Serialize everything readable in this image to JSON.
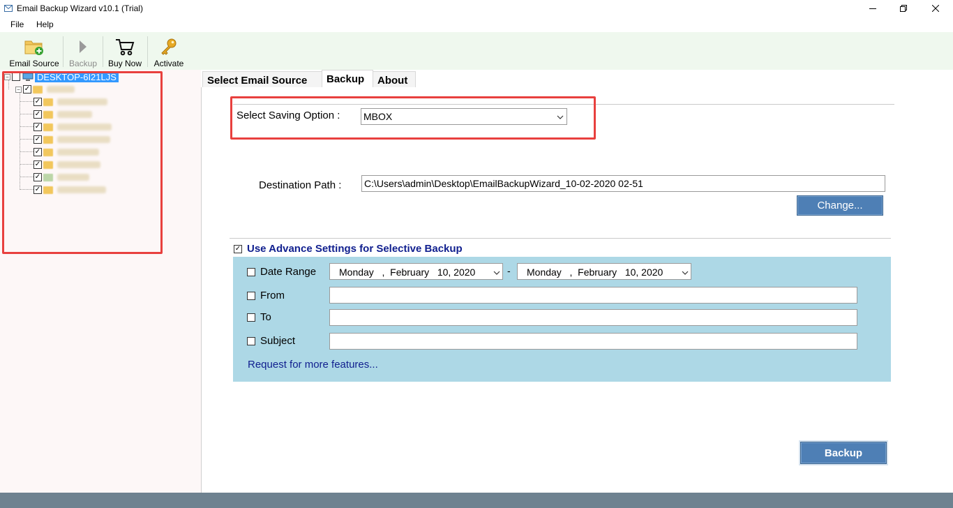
{
  "window": {
    "title": "Email Backup Wizard v10.1 (Trial)"
  },
  "menu": {
    "file": "File",
    "help": "Help"
  },
  "toolbar": {
    "email_source": "Email Source",
    "backup": "Backup",
    "buy_now": "Buy Now",
    "activate": "Activate"
  },
  "tree": {
    "root_label": "DESKTOP-6I21LJS",
    "root_checked": false,
    "children_checked": true
  },
  "tabs": {
    "select_email_source": "Select Email Source",
    "backup": "Backup",
    "about": "About",
    "active": "Backup"
  },
  "saving": {
    "label": "Select Saving Option :",
    "selected": "MBOX"
  },
  "destination": {
    "label": "Destination Path :",
    "value": "C:\\Users\\admin\\Desktop\\EmailBackupWizard_10-02-2020 02-51",
    "change_button": "Change..."
  },
  "advanced": {
    "label": "Use Advance Settings for Selective Backup",
    "checked": true,
    "date_range_label": "Date Range",
    "date_from": "Monday   ,  February   10, 2020",
    "date_separator": "-",
    "date_to": "Monday   ,  February   10, 2020",
    "from_label": "From",
    "to_label": "To",
    "subject_label": "Subject",
    "request_link": "Request for more features..."
  },
  "actions": {
    "backup_button": "Backup"
  },
  "colors": {
    "highlight_red": "#e8403e",
    "button_blue": "#4e7fb5",
    "panel_blue": "#add8e6",
    "link_navy": "#11208f",
    "toolbar_green": "#eff8ee"
  }
}
